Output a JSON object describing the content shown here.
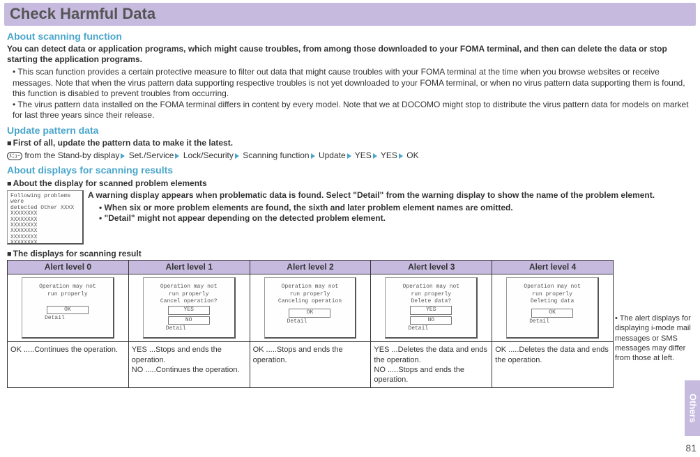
{
  "title": "Check Harmful Data",
  "sideTab": "Others",
  "pageNumber": "81",
  "scanning": {
    "heading": "About scanning function",
    "intro": "You can detect data or application programs, which might cause troubles, from among those downloaded to your FOMA terminal, and then can delete the data or stop starting the application programs.",
    "bullets": [
      "This scan function provides a certain protective measure to filter out data that might cause troubles with your FOMA terminal at the time when you browse websites or receive messages. Note that when the virus pattern data supporting respective troubles is not yet downloaded to your FOMA terminal, or when no virus pattern data supporting them is found, this function is disabled to prevent troubles from occurring.",
      "The virus pattern data installed on the FOMA terminal differs in content by every model. Note that we at DOCOMO might stop to distribute the virus pattern data for models on market for last three years since their release."
    ]
  },
  "update": {
    "heading": "Update pattern data",
    "sub": "First of all, update the pattern data to make it the latest.",
    "menuLabel": "ﾒﾆｭｰ",
    "path": [
      "from the Stand-by display",
      "Set./Service",
      "Lock/Security",
      "Scanning function",
      "Update",
      "YES",
      "YES",
      "OK"
    ]
  },
  "results": {
    "heading": "About displays for scanning results",
    "sub1": "About the display for scanned problem elements",
    "mock1": {
      "line1": "Following problems were",
      "line2": "detected     Other XXXX",
      "names": [
        "XXXXXXXX",
        "XXXXXXXX",
        "XXXXXXXX",
        "XXXXXXXX",
        "XXXXXXXX",
        "XXXXXXXX"
      ]
    },
    "warn": "A warning display appears when problematic data is found. Select \"Detail\" from the warning display to show the name of the problem element.",
    "warnBullets": [
      "When six or more problem elements are found, the sixth and later problem element names are omitted.",
      "\"Detail\" might not appear depending on the detected problem element."
    ],
    "sub2": "The displays for scanning result"
  },
  "table": {
    "headers": [
      "Alert level 0",
      "Alert level 1",
      "Alert level 2",
      "Alert level 3",
      "Alert level 4"
    ],
    "screens": [
      {
        "l1": "Operation may not",
        "l2": "run properly",
        "l3": "",
        "btn": [
          "OK"
        ],
        "detail": "Detail"
      },
      {
        "l1": "Operation may not",
        "l2": "run properly",
        "l3": "Cancel operation?",
        "btn": [
          "YES",
          "NO"
        ],
        "detail": "Detail"
      },
      {
        "l1": "Operation may not",
        "l2": "run properly",
        "l3": "Canceling operation",
        "btn": [
          "OK"
        ],
        "detail": "Detail"
      },
      {
        "l1": "Operation may not",
        "l2": "run properly",
        "l3": "Delete data?",
        "btn": [
          "YES",
          "NO"
        ],
        "detail": "Detail"
      },
      {
        "l1": "Operation may not",
        "l2": "run properly",
        "l3": "Deleting data",
        "btn": [
          "OK"
        ],
        "detail": "Detail"
      }
    ],
    "desc": [
      "OK .....Continues the operation.",
      "YES ...Stops and ends the operation.\nNO .....Continues the operation.",
      "OK .....Stops and ends the operation.",
      "YES ...Deletes the data and ends the operation.\nNO .....Stops and ends the operation.",
      "OK .....Deletes the data and ends the operation."
    ]
  },
  "sideNote": "• The alert displays for displaying i-mode mail messages or SMS messages may differ from those at left."
}
